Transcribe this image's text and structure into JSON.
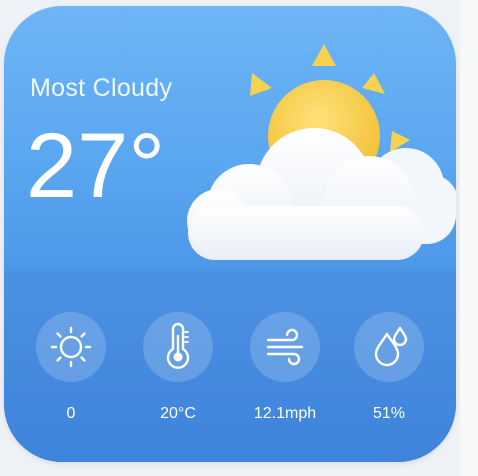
{
  "widget": {
    "condition": "Most Cloudy",
    "temperature": "27°",
    "weather_icon": "sun-behind-cloud-icon"
  },
  "stats": [
    {
      "icon": "sun-icon",
      "value": "0"
    },
    {
      "icon": "thermometer-icon",
      "value": "20°C"
    },
    {
      "icon": "wind-icon",
      "value": "12.1mph"
    },
    {
      "icon": "humidity-drops-icon",
      "value": "51%"
    }
  ],
  "colors": {
    "top_gradient": "#6db5f5",
    "bottom_band": "#4a90e2",
    "sun": "#f7d04a",
    "sun_rays": "#f6d24f",
    "cloud": "#ffffff",
    "text": "#ffffff"
  }
}
